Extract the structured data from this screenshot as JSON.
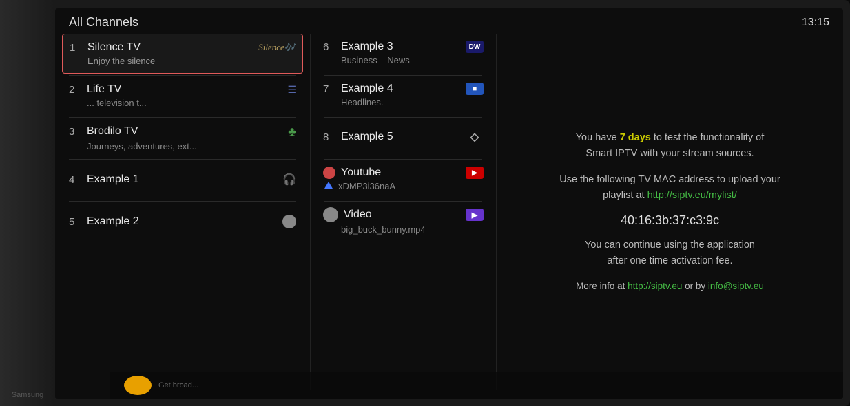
{
  "header": {
    "title": "All Channels",
    "time": "13:15"
  },
  "left_channels": [
    {
      "number": "1",
      "name": "Silence TV",
      "logo": "Silence",
      "subtitle": "Enjoy the silence",
      "active": true
    },
    {
      "number": "2",
      "name": "Life TV",
      "logo": "",
      "subtitle": "... television t..."
    },
    {
      "number": "3",
      "name": "Brodilo TV",
      "logo": "",
      "subtitle": "Journeys, adventures, ext..."
    },
    {
      "number": "4",
      "name": "Example 1",
      "logo": "",
      "subtitle": ""
    },
    {
      "number": "5",
      "name": "Example 2",
      "logo": "",
      "subtitle": ""
    }
  ],
  "right_channels": [
    {
      "number": "6",
      "name": "Example 3",
      "icon_type": "dw",
      "icon_label": "DW",
      "subtitle": "Business – News"
    },
    {
      "number": "7",
      "name": "Example 4",
      "icon_type": "blue",
      "icon_label": "■",
      "subtitle": "Headlines."
    },
    {
      "number": "8",
      "name": "Example 5",
      "icon_type": "diamond",
      "icon_label": "◇",
      "subtitle": ""
    },
    {
      "number": "",
      "name": "Youtube",
      "icon_type": "youtube",
      "icon_label": "▶",
      "subtitle": "xDMP3i36naA"
    },
    {
      "number": "",
      "name": "Video",
      "icon_type": "video",
      "icon_label": "▶",
      "subtitle": "big_buck_bunny.mp4"
    }
  ],
  "info_panel": {
    "line1": "You have ",
    "line1_highlight": "7 days",
    "line1_rest": " to test the functionality of Smart IPTV with your stream sources.",
    "line2": "Use the following TV MAC address to upload your playlist at ",
    "line2_link": "http://siptv.eu/mylist/",
    "mac": "40:16:3b:37:c3:9c",
    "line3": "You can continue using the application after one time activation fee.",
    "line4": "More info at ",
    "link1": "http://siptv.eu",
    "line4_mid": " or by ",
    "link2": "info@siptv.eu"
  },
  "icons": {
    "clover": "♣",
    "headphone": "🎧",
    "diamond": "◇",
    "triangle_up": "▲",
    "circle": "●"
  }
}
